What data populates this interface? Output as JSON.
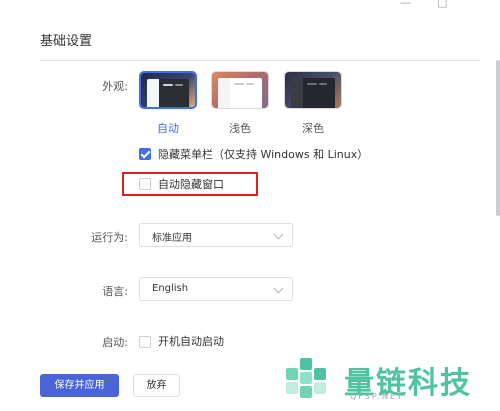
{
  "window": {
    "minimize_glyph": "—",
    "maximize_glyph": "□"
  },
  "section": {
    "title": "基础设置"
  },
  "appearance": {
    "label": "外观:",
    "themes": [
      {
        "name": "自动",
        "selected": true
      },
      {
        "name": "浅色",
        "selected": false
      },
      {
        "name": "深色",
        "selected": false
      }
    ]
  },
  "options": {
    "hide_menubar": {
      "label": "隐藏菜单栏（仅支持 Windows 和 Linux）",
      "checked": true
    },
    "auto_hide_window": {
      "label": "自动隐藏窗口",
      "checked": false
    }
  },
  "run_as": {
    "label": "运行为:",
    "value": "标准应用"
  },
  "language": {
    "label": "语言:",
    "value": "English"
  },
  "startup": {
    "label": "启动:",
    "option_label": "开机自动启动",
    "checked": false
  },
  "buttons": {
    "save": "保存并应用",
    "discard": "放弃"
  },
  "watermark": {
    "brand": "量链科技",
    "domain": "QFSP.NET"
  },
  "colors": {
    "accent": "#3f6ee6",
    "button": "#4a63d6",
    "highlight": "#e02020",
    "brand": "#4fc3a1"
  }
}
